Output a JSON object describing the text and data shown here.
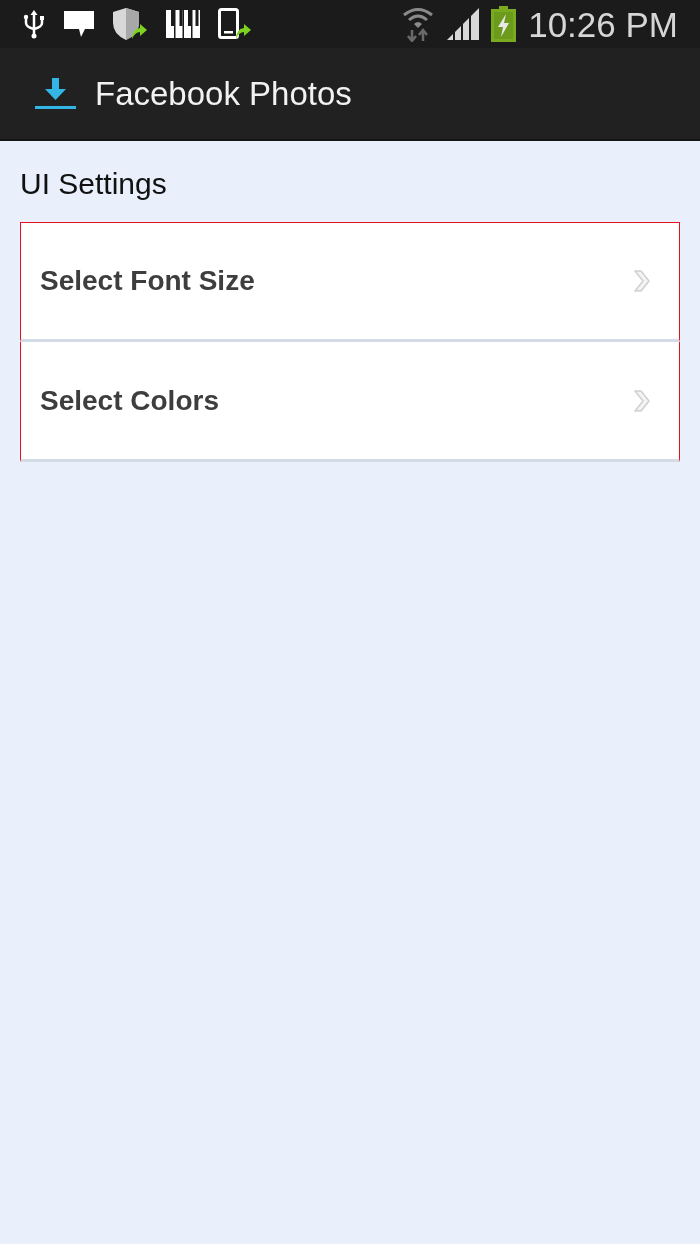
{
  "status_bar": {
    "time": "10:26 PM"
  },
  "action_bar": {
    "title": "Facebook Photos"
  },
  "section": {
    "title": "UI Settings"
  },
  "items": [
    {
      "label": "Select Font Size"
    },
    {
      "label": "Select Colors"
    }
  ]
}
